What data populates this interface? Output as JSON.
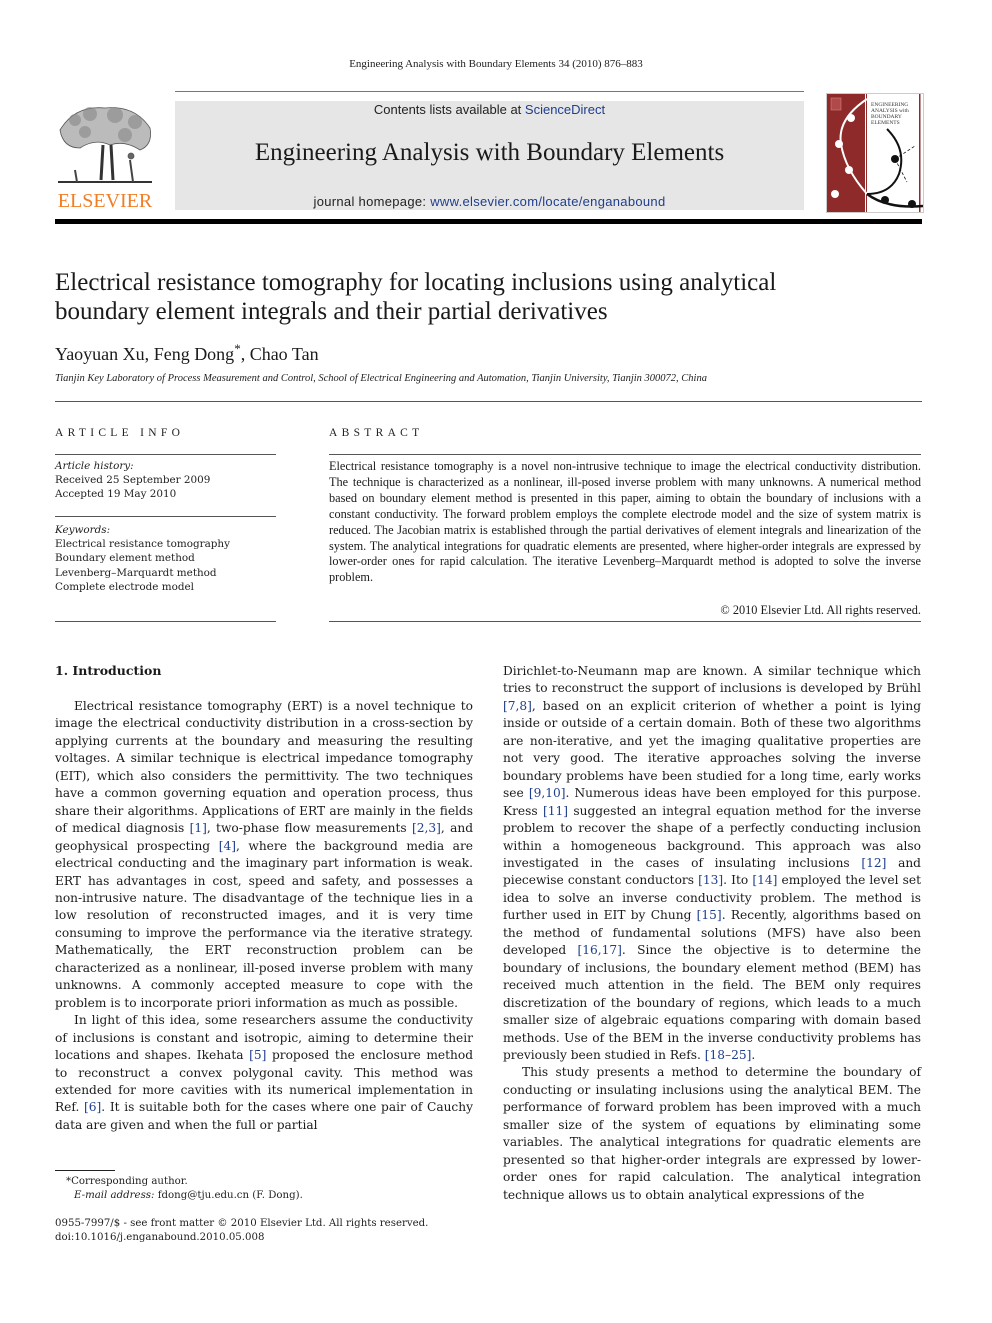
{
  "running_head": "Engineering Analysis with Boundary Elements 34 (2010) 876–883",
  "header": {
    "publisher": "ELSEVIER",
    "contents_prefix": "Contents lists available at ",
    "contents_link": "ScienceDirect",
    "journal_title": "Engineering Analysis with Boundary Elements",
    "homepage_prefix": "journal homepage: ",
    "homepage_link": "www.elsevier.com/locate/enganabound",
    "cover_lines": [
      "ENGINEERING",
      "ANALYSIS with",
      "BOUNDARY",
      "ELEMENTS"
    ],
    "colors": {
      "publisher_orange": "#f07e26",
      "cover_red": "#8e2a2a",
      "link_blue": "#1f3e8c",
      "banner_gray": "#e6e6e6"
    }
  },
  "article": {
    "title_line1": "Electrical resistance tomography for locating inclusions using analytical",
    "title_line2": "boundary element integrals and their partial derivatives",
    "authors": {
      "a1": "Yaoyuan Xu, ",
      "a2": "Feng Dong",
      "a2_mark": "*",
      "a3": ", Chao Tan"
    },
    "affiliation": "Tianjin Key Laboratory of Process Measurement and Control, School of Electrical Engineering and Automation, Tianjin University, Tianjin 300072, China"
  },
  "article_info": {
    "label": "ARTICLE INFO",
    "history_label": "Article history:",
    "received": "Received 25 September 2009",
    "accepted": "Accepted 19 May 2010",
    "keywords_label": "Keywords:",
    "keywords": [
      "Electrical resistance tomography",
      "Boundary element method",
      "Levenberg–Marquardt method",
      "Complete electrode model"
    ]
  },
  "abstract": {
    "label": "ABSTRACT",
    "text": "Electrical resistance tomography is a novel non-intrusive technique to image the electrical conductivity distribution. The technique is characterized as a nonlinear, ill-posed inverse problem with many unknowns. A numerical method based on boundary element method is presented in this paper, aiming to obtain the boundary of inclusions with a constant conductivity. The forward problem employs the complete electrode model and the size of system matrix is reduced. The Jacobian matrix is established through the partial derivatives of element integrals and linearization of the system. The analytical integrations for quadratic elements are presented, where higher-order integrals are expressed by lower-order ones for rapid calculation. The iterative Levenberg–Marquardt method is adopted to solve the inverse problem.",
    "copyright": "© 2010 Elsevier Ltd. All rights reserved."
  },
  "introduction": {
    "heading": "1.  Introduction",
    "left": {
      "p1": [
        "Electrical resistance tomography (ERT) is a novel technique to image the electrical conductivity distribution in a cross-section by applying currents at the boundary and measuring the resulting voltages. A similar technique is electrical impedance tomography (EIT), which also considers the permittivity. The two techniques have a common governing equation and operation process, thus share their algorithms. Applications of ERT are mainly in the fields of medical diagnosis ",
        "[1]",
        ", two-phase flow measurements ",
        "[2,3]",
        ", and geophysical prospecting ",
        "[4]",
        ", where the background media are electrical conducting and the imaginary part information is weak. ERT has advantages in cost, speed and safety, and possesses a non-intrusive nature. The disadvantage of the technique lies in a low resolution of reconstructed images, and it is very time consuming to improve the performance via the iterative strategy. Mathematically, the ERT reconstruction problem can be characterized as a nonlinear, ill-posed inverse problem with many unknowns. A commonly accepted measure to cope with the problem is to incorporate priori information as much as possible."
      ],
      "p2": [
        "In light of this idea, some researchers assume the conductivity of inclusions is constant and isotropic, aiming to determine their locations and shapes. Ikehata ",
        "[5]",
        " proposed the enclosure method to reconstruct a convex polygonal cavity. This method was extended for more cavities with its numerical implementation in Ref. ",
        "[6]",
        ". It is suitable both for the cases where one pair of Cauchy data are given and when the full or partial"
      ]
    },
    "right": {
      "p1": [
        "Dirichlet-to-Neumann map are known. A similar technique which tries to reconstruct the support of inclusions is developed by Brühl ",
        "[7,8]",
        ", based on an explicit criterion of whether a point is lying inside or outside of a certain domain. Both of these two algorithms are non-iterative, and yet the imaging qualitative properties are not very good. The iterative approaches solving the inverse boundary problems have been studied for a long time, early works see ",
        "[9,10]",
        ". Numerous ideas have been employed for this purpose. Kress ",
        "[11]",
        " suggested an integral equation method for the inverse problem to recover the shape of a perfectly conducting inclusion within a homogeneous background. This approach was also investigated in the cases of insulating inclusions ",
        "[12]",
        " and piecewise constant conductors ",
        "[13]",
        ". Ito ",
        "[14]",
        " employed the level set idea to solve an inverse conductivity problem. The method is further used in EIT by Chung ",
        "[15]",
        ". Recently, algorithms based on the method of fundamental solutions (MFS) have also been developed ",
        "[16,17]",
        ". Since the objective is to determine the boundary of inclusions, the boundary element method (BEM) has received much attention in the field. The BEM only requires discretization of the boundary of regions, which leads to a much smaller size of algebraic equations comparing with domain based methods. Use of the BEM in the inverse conductivity problems has previously been studied in Refs. ",
        "[18–25]",
        "."
      ],
      "p2": [
        "This study presents a method to determine the boundary of conducting or insulating inclusions using the analytical BEM. The performance of forward problem has been improved with a much smaller size of the system of equations by eliminating some variables. The analytical integrations for quadratic elements are presented so that higher-order integrals are expressed by lower-order ones for rapid calculation. The analytical integration technique allows us to obtain analytical expressions of the"
      ]
    }
  },
  "footnotes": {
    "corresponding_mark": "*",
    "corresponding": "Corresponding author.",
    "email_label": "E-mail address:",
    "email": " fdong@tju.edu.cn (F. Dong).",
    "issn_line": "0955-7997/$ - see front matter © 2010 Elsevier Ltd. All rights reserved.",
    "doi_line": "doi:10.1016/j.enganabound.2010.05.008"
  }
}
